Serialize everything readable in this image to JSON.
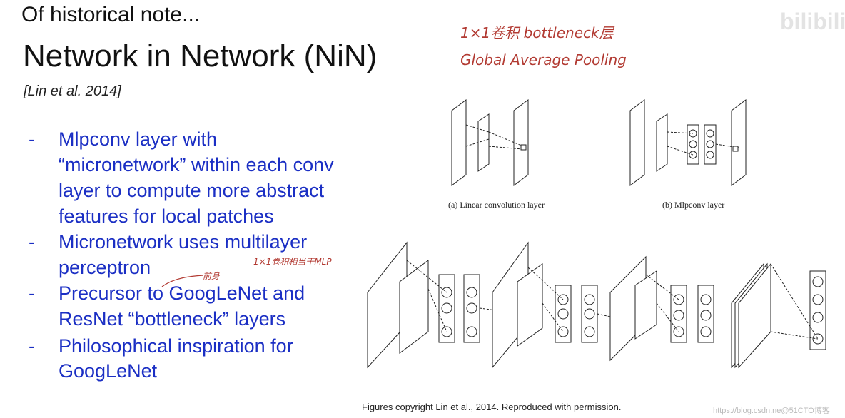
{
  "slide": {
    "heading": "Of historical note...",
    "title": "Network in Network (NiN)",
    "citation": "[Lin et al. 2014]",
    "bullets": [
      {
        "lines": [
          "Mlpconv layer with",
          "“micronetwork” within each conv",
          "layer to compute more abstract",
          "features for local patches"
        ]
      },
      {
        "lines": [
          "Micronetwork uses multilayer",
          "perceptron"
        ]
      },
      {
        "lines": [
          "Precursor to GoogLeNet and",
          "ResNet “bottleneck” layers"
        ]
      },
      {
        "lines": [
          "Philosophical inspiration for",
          "GoogLeNet"
        ]
      }
    ],
    "bullet_marker": "-",
    "figure_captions": {
      "a": "(a) Linear convolution layer",
      "b": "(b) Mlpconv layer"
    },
    "figure_credit": "Figures copyright Lin et al., 2014. Reproduced with permission."
  },
  "annotations": {
    "note1": "1×1卷积  bottleneck层",
    "note2": "Global Average Pooling",
    "note3": "1×1卷积相当于MLP",
    "note4": "前身",
    "color": "#b23a32"
  },
  "watermarks": {
    "top": "bilibili",
    "bottom": "https://blog.csdn.ne@51CTO博客"
  },
  "colors": {
    "bullet_text": "#1b2fc4"
  }
}
